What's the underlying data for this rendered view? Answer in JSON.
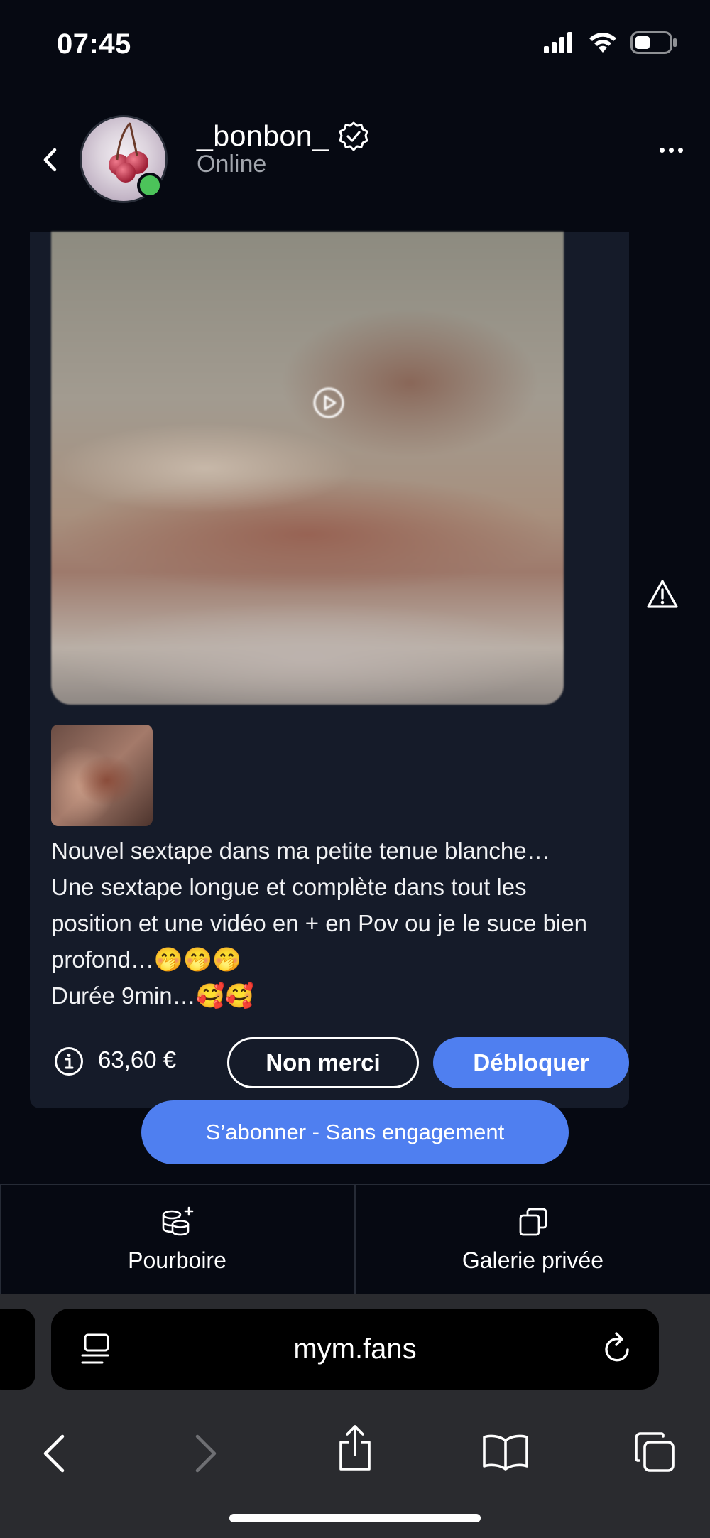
{
  "status_bar": {
    "time": "07:45"
  },
  "header": {
    "username": "_bonbon_",
    "status": "Online",
    "verified": true
  },
  "message": {
    "description": "Nouvel sextape dans ma petite tenue blanche…\nUne sextape longue et complète dans tout les position et une vidéo en + en Pov ou je le suce bien profond…🤭🤭🤭\nDurée 9min…🥰🥰",
    "price": "63,60 €",
    "decline_label": "Non merci",
    "unlock_label": "Débloquer"
  },
  "subscribe_label": "S’abonner - Sans engagement",
  "bottom_tabs": [
    {
      "label": "Pourboire",
      "icon": "coins-plus-icon"
    },
    {
      "label": "Galerie privée",
      "icon": "gallery-icon"
    }
  ],
  "browser": {
    "url": "mym.fans"
  },
  "colors": {
    "background": "#060912",
    "card": "#151b29",
    "accent": "#4f7ff0",
    "online": "#4cc35a"
  }
}
